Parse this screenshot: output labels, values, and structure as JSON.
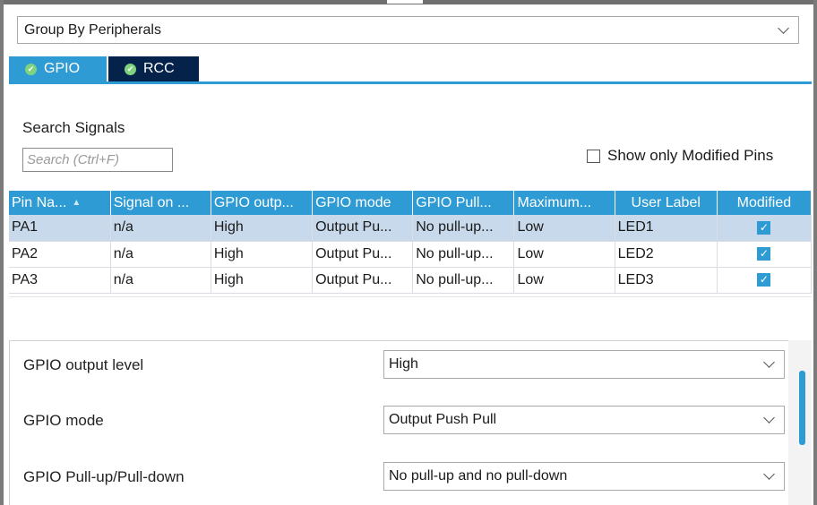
{
  "group_by": {
    "value": "Group By Peripherals"
  },
  "tabs": [
    {
      "label": "GPIO",
      "active": true
    },
    {
      "label": "RCC",
      "active": false
    }
  ],
  "search": {
    "label": "Search Signals",
    "placeholder": "Search (Ctrl+F)"
  },
  "show_modified": {
    "label": "Show only Modified Pins",
    "checked": false
  },
  "table": {
    "columns": [
      "Pin Na...",
      "Signal on ...",
      "GPIO outp...",
      "GPIO mode",
      "GPIO Pull...",
      "Maximum...",
      "User Label",
      "Modified"
    ],
    "rows": [
      {
        "cells": [
          "PA1",
          "n/a",
          "High",
          "Output Pu...",
          "No pull-up...",
          "Low",
          "LED1"
        ],
        "modified": true,
        "selected": true
      },
      {
        "cells": [
          "PA2",
          "n/a",
          "High",
          "Output Pu...",
          "No pull-up...",
          "Low",
          "LED2"
        ],
        "modified": true,
        "selected": false
      },
      {
        "cells": [
          "PA3",
          "n/a",
          "High",
          "Output Pu...",
          "No pull-up...",
          "Low",
          "LED3"
        ],
        "modified": true,
        "selected": false
      }
    ]
  },
  "config": {
    "output_level": {
      "label": "GPIO output level",
      "value": "High"
    },
    "mode": {
      "label": "GPIO mode",
      "value": "Output Push Pull"
    },
    "pull": {
      "label": "GPIO Pull-up/Pull-down",
      "value": "No pull-up and no pull-down"
    }
  },
  "colors": {
    "accent": "#2f9bd4",
    "tab_inactive": "#04224a",
    "selected_row": "#c7d9eb",
    "check_green": "#7fd37f"
  },
  "icons": {
    "dropdown": "chevron-down-icon",
    "tab_status": "check-circle-icon",
    "sort": "sort-icon",
    "checkbox": "checkbox-icon"
  }
}
